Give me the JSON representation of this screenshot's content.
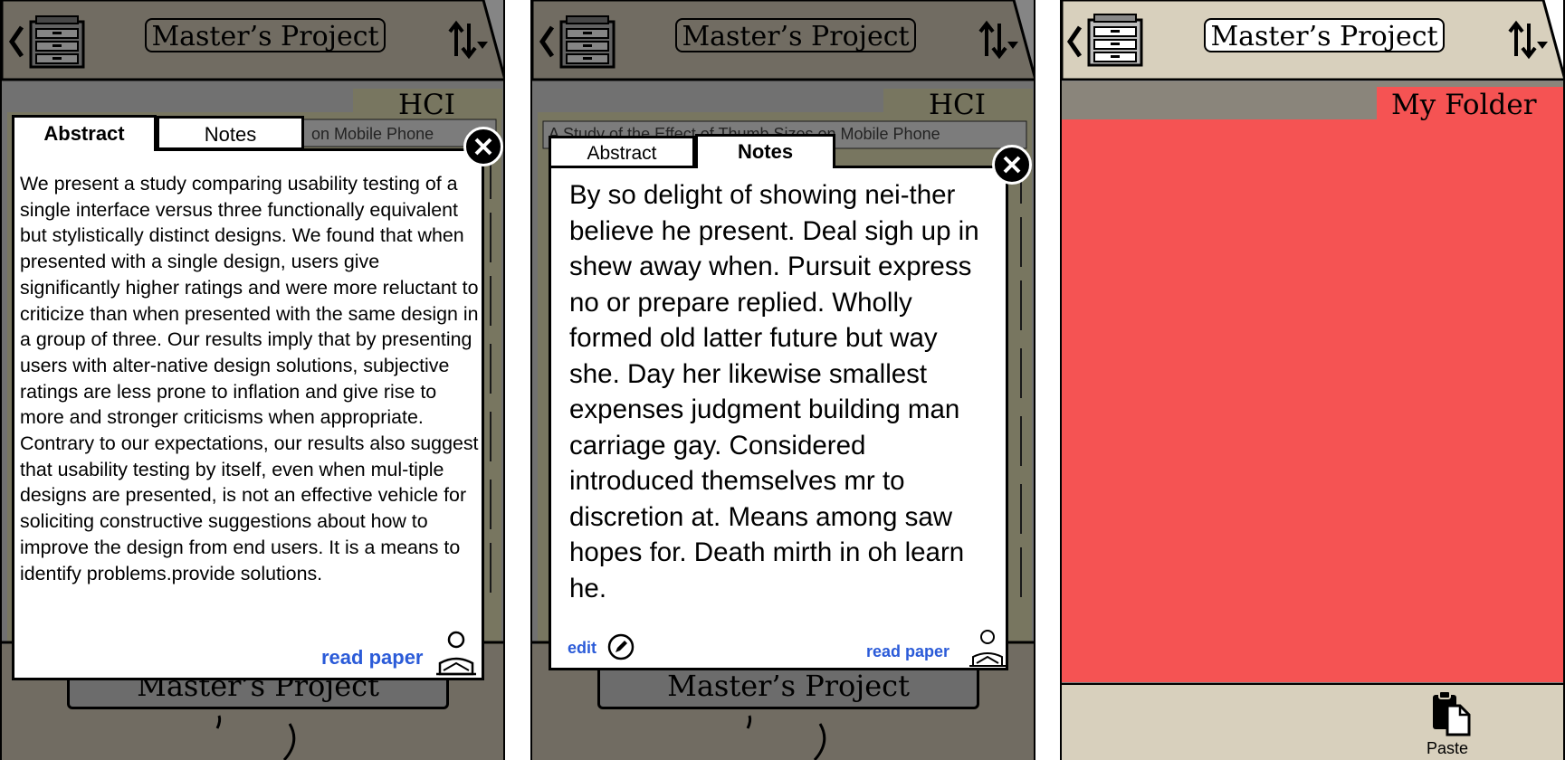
{
  "header": {
    "title": "Master’s Project",
    "back_icon": "chevron-left-icon",
    "cabinet_icon": "file-cabinet-icon",
    "sort_icon": "sort-icon"
  },
  "screen1": {
    "folder_label": "HCI",
    "behind_item": "on Mobile Phone",
    "bottom_title": "Master’s Project",
    "tabs": [
      "Abstract",
      "Notes"
    ],
    "abstract_text": "We present a study comparing usability testing of a single interface versus three functionally equivalent but stylistically distinct designs. We found that when presented with a single design, users give significantly higher ratings and were more reluctant to criticize than when presented with the same design in a group of three. Our results imply that by presenting users with alter-native design solutions, subjective ratings are less prone to inflation and give rise to more and stronger criticisms when appropriate. Contrary to our expectations, our results also suggest that usability testing by itself, even when mul-tiple designs are presented, is not an effective vehicle for soliciting constructive suggestions about how to improve the design from end users. It is a means to identify problems.provide solutions.",
    "read_paper": "read paper"
  },
  "screen2": {
    "folder_label": "HCI",
    "behind_item": "A Study of the Effect of Thumb Sizes on Mobile Phone",
    "bottom_title": "Master’s Project",
    "tabs": [
      "Abstract",
      "Notes"
    ],
    "notes_text": "By so delight of showing nei-ther believe he present. Deal sigh up in shew away when. Pursuit express no or prepare replied. Wholly formed old latter future but way she. Day her likewise smallest expenses judgment building man carriage gay. Considered introduced themselves mr to discretion at. Means among saw hopes for. Death mirth in oh learn he.",
    "edit_label": "edit",
    "read_paper": "read paper"
  },
  "screen3": {
    "folder_label": "My Folder",
    "paste_label": "Paste",
    "colors": {
      "folder_red": "#f55353",
      "chrome_beige": "#d8d0bd",
      "folder_tab_gray": "#8a857b"
    }
  }
}
